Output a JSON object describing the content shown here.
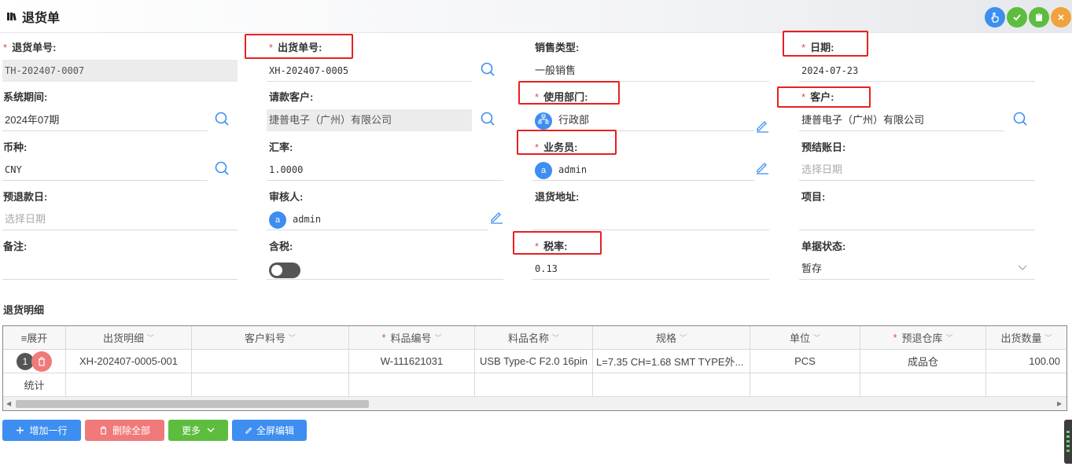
{
  "header": {
    "title": "退货单",
    "accent_colors": {
      "blue": "#3d8ef0",
      "green": "#5cbd3e",
      "orange": "#f0a23c"
    }
  },
  "form": {
    "return_no": {
      "label": "退货单号:",
      "value": "TH-202407-0007"
    },
    "shipment_no": {
      "label": "出货单号:",
      "value": "XH-202407-0005"
    },
    "sales_type": {
      "label": "销售类型:",
      "value": "一般销售"
    },
    "date": {
      "label": "日期:",
      "value": "2024-07-23"
    },
    "period": {
      "label": "系统期间:",
      "value": "2024年07期"
    },
    "billing_customer": {
      "label": "请款客户:",
      "value": "捷普电子（广州）有限公司"
    },
    "department": {
      "label": "使用部门:",
      "value": "行政部"
    },
    "customer": {
      "label": "客户:",
      "value": "捷普电子（广州）有限公司"
    },
    "currency": {
      "label": "币种:",
      "value": "CNY"
    },
    "exchange_rate": {
      "label": "汇率:",
      "value": "1.0000"
    },
    "salesperson": {
      "label": "业务员:",
      "value": "admin",
      "avatar": "a"
    },
    "pre_settle_date": {
      "label": "预结账日:",
      "placeholder": "选择日期"
    },
    "pre_refund_date": {
      "label": "预退款日:",
      "placeholder": "选择日期"
    },
    "reviewer": {
      "label": "审核人:",
      "value": "admin",
      "avatar": "a"
    },
    "return_address": {
      "label": "退货地址:",
      "value": ""
    },
    "project": {
      "label": "项目:",
      "value": ""
    },
    "remark": {
      "label": "备注:",
      "value": ""
    },
    "tax_included": {
      "label": "含税:",
      "on": false
    },
    "tax_rate": {
      "label": "税率:",
      "value": "0.13"
    },
    "doc_status": {
      "label": "单据状态:",
      "value": "暂存"
    }
  },
  "detail": {
    "section_title": "退货明细",
    "columns": [
      "≡展开",
      "出货明细",
      "客户料号",
      "料品编号",
      "料品名称",
      "规格",
      "单位",
      "预退仓库",
      "出货数量"
    ],
    "rows": [
      {
        "index": "1",
        "shipment_detail": "XH-202407-0005-001",
        "customer_part": "",
        "item_code": "W-111621031",
        "item_name": "USB Type-C F2.0 16pin",
        "spec": "L=7.35 CH=1.68 SMT TYPE外...",
        "unit": "PCS",
        "warehouse": "成品仓",
        "qty": "100.00"
      }
    ],
    "summary_label": "统计"
  },
  "actions": {
    "add_row": "增加一行",
    "delete_all": "删除全部",
    "more": "更多",
    "fullscreen_edit": "全屏编辑"
  }
}
